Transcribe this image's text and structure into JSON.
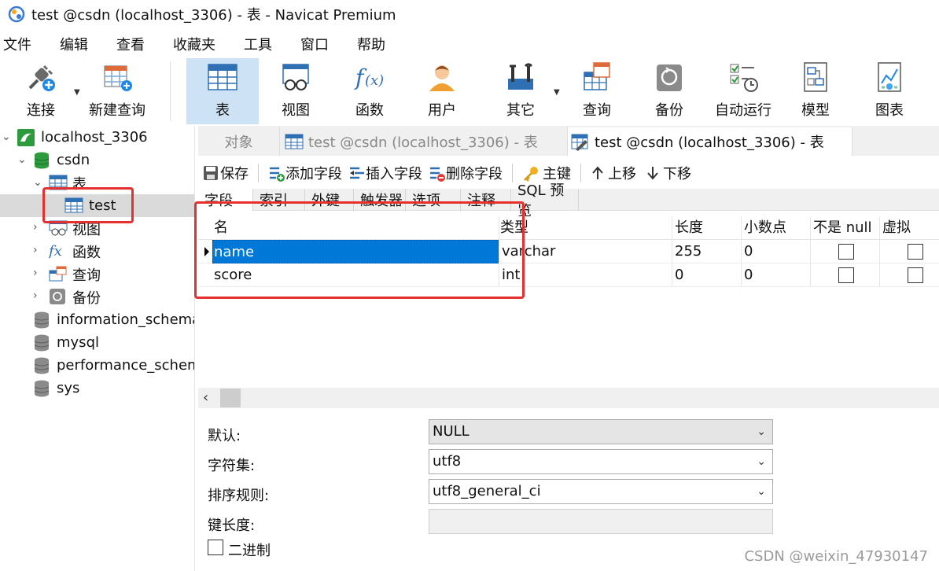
{
  "window": {
    "title": "test @csdn (localhost_3306) - 表 - Navicat Premium"
  },
  "menu": [
    "文件",
    "编辑",
    "查看",
    "收藏夹",
    "工具",
    "窗口",
    "帮助"
  ],
  "toolbar": {
    "connect": "连接",
    "new_query": "新建查询",
    "table": "表",
    "view": "视图",
    "function": "函数",
    "user": "用户",
    "other": "其它",
    "query": "查询",
    "backup": "备份",
    "automation": "自动运行",
    "model": "模型",
    "chart": "图表"
  },
  "navigator": {
    "connection": "localhost_3306",
    "database": "csdn",
    "tables_group": "表",
    "table_item": "test",
    "views_group": "视图",
    "functions_group": "函数",
    "queries_group": "查询",
    "backups_group": "备份",
    "other_dbs": [
      "information_schema",
      "mysql",
      "performance_schema",
      "sys"
    ]
  },
  "tabs": {
    "objects": "对象",
    "tab1": "test @csdn (localhost_3306) - 表",
    "tab2": "test @csdn (localhost_3306) - 表"
  },
  "designer_toolbar": {
    "save": "保存",
    "add_field": "添加字段",
    "insert_field": "插入字段",
    "delete_field": "删除字段",
    "primary_key": "主键",
    "move_up": "上移",
    "move_down": "下移"
  },
  "subtabs": [
    "字段",
    "索引",
    "外键",
    "触发器",
    "选项",
    "注释",
    "SQL 预览"
  ],
  "grid": {
    "headers": {
      "name": "名",
      "type": "类型",
      "length": "长度",
      "decimals": "小数点",
      "not_null": "不是 null",
      "virtual": "虚拟"
    },
    "rows": [
      {
        "name": "name",
        "type": "varchar",
        "length": "255",
        "decimals": "0",
        "not_null": false,
        "virtual": false
      },
      {
        "name": "score",
        "type": "int",
        "length": "0",
        "decimals": "0",
        "not_null": false,
        "virtual": false
      }
    ]
  },
  "properties": {
    "default_label": "默认:",
    "default_value": "NULL",
    "charset_label": "字符集:",
    "charset_value": "utf8",
    "collation_label": "排序规则:",
    "collation_value": "utf8_general_ci",
    "key_length_label": "键长度:",
    "key_length_value": "",
    "binary_label": "二进制",
    "binary_checked": false
  },
  "watermark": "CSDN @weixin_47930147",
  "colors": {
    "accent": "#0078d7",
    "active_tool": "#cde3f5",
    "annotation": "#e53030"
  }
}
